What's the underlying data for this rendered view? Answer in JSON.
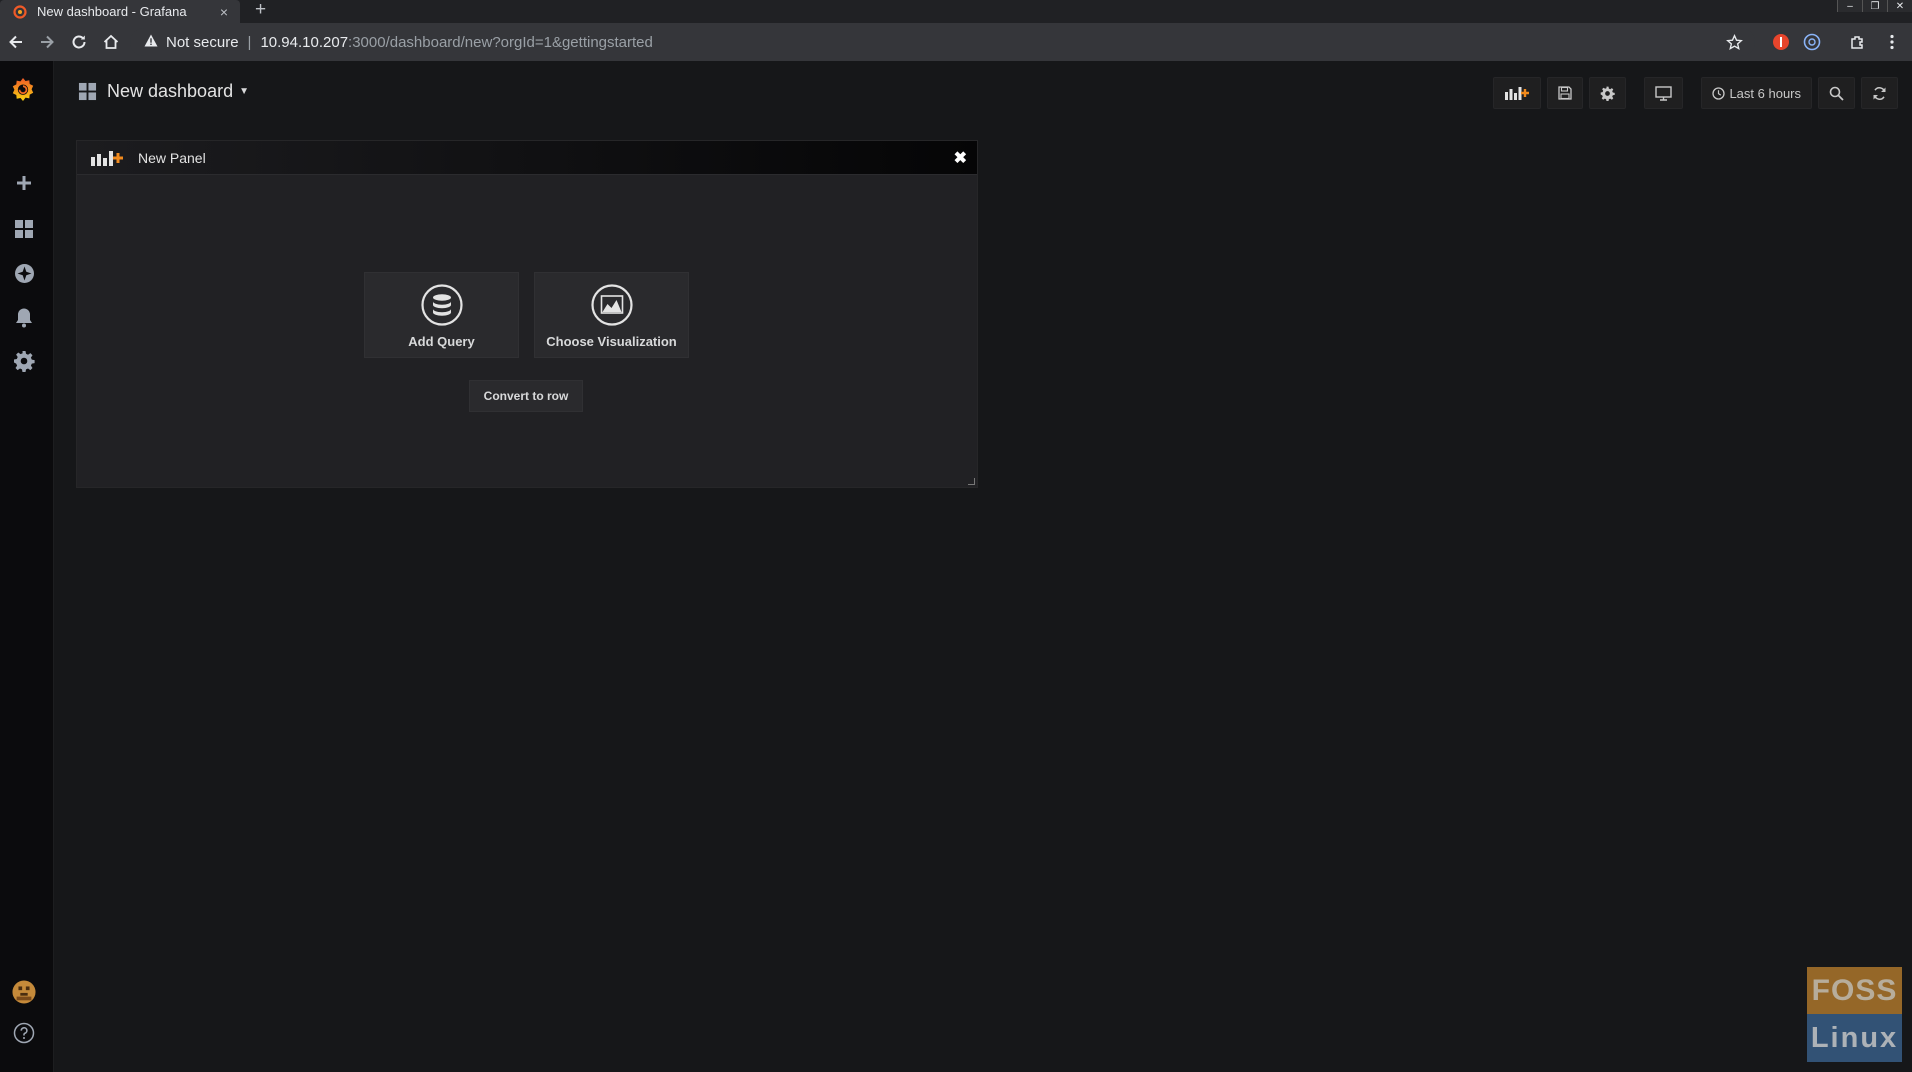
{
  "browser": {
    "tab_title": "New dashboard - Grafana",
    "tab_close": "×",
    "new_tab": "+",
    "security_label": "Not secure",
    "url_host": "10.94.10.207",
    "url_path": ":3000/dashboard/new?orgId=1&gettingstarted",
    "window_controls": [
      "–",
      "❐",
      "✕"
    ]
  },
  "grafana": {
    "dashboard_title": "New dashboard",
    "time_picker_label": "Last 6 hours",
    "panel": {
      "title": "New Panel",
      "close_glyph": "✖",
      "add_query_label": "Add Query",
      "choose_visualization_label": "Choose Visualization",
      "convert_to_row_label": "Convert to row"
    }
  },
  "watermark": {
    "top": "FOSS",
    "bottom": "Linux"
  },
  "colors": {
    "grafana_orange": "#f05a28",
    "background": "#161719",
    "sidemenu": "#0b0b0d"
  }
}
